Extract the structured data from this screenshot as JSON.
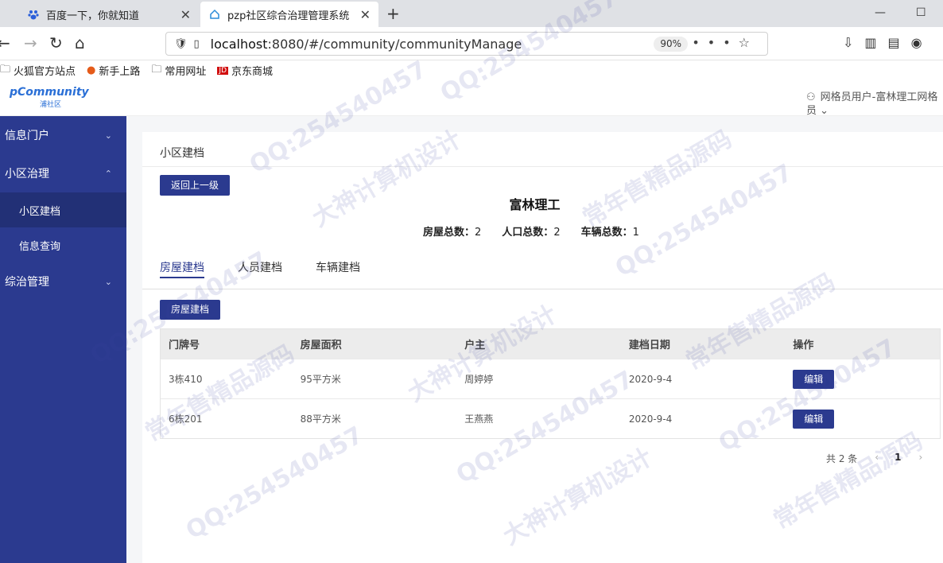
{
  "browser": {
    "tabs": [
      {
        "title": "百度一下，你就知道",
        "active": false
      },
      {
        "title": "pzp社区综合治理管理系统",
        "active": true
      }
    ],
    "url": {
      "host": "localhost",
      "rest": ":8080/#/community/communityManage"
    },
    "zoom": "90%",
    "bookmarks": [
      "火狐官方站点",
      "新手上路",
      "常用网址",
      "京东商城"
    ]
  },
  "app": {
    "logo": {
      "brand": "pCommunity",
      "sub": "浦社区"
    },
    "user": "网格员用户-富林理工网格员"
  },
  "sidebar": {
    "items": [
      {
        "label": "信息门户",
        "arrow": "⌄"
      },
      {
        "label": "小区治理",
        "arrow": "⌃",
        "children": [
          {
            "label": "小区建档",
            "active": true
          },
          {
            "label": "信息查询",
            "active": false
          }
        ]
      },
      {
        "label": "综治管理",
        "arrow": "⌄"
      }
    ]
  },
  "main": {
    "title": "小区建档",
    "back_label": "返回上一级",
    "community_name": "富林理工",
    "stats": [
      {
        "label": "房屋总数：",
        "value": "2"
      },
      {
        "label": "人口总数：",
        "value": "2"
      },
      {
        "label": "车辆总数：",
        "value": "1"
      }
    ],
    "subtabs": [
      "房屋建档",
      "人员建档",
      "车辆建档"
    ],
    "add_label": "房屋建档",
    "table": {
      "headers": [
        "门牌号",
        "房屋面积",
        "户主",
        "建档日期",
        "操作"
      ],
      "rows": [
        {
          "door": "3栋410",
          "area": "95平方米",
          "owner": "周婷婷",
          "date": "2020-9-4",
          "action": "编辑"
        },
        {
          "door": "6栋201",
          "area": "88平方米",
          "owner": "王燕燕",
          "date": "2020-9-4",
          "action": "编辑"
        }
      ]
    },
    "pager": {
      "total": "共 2 条",
      "page": "1"
    }
  },
  "watermarks": [
    "QQ:254540457",
    "常年售精品源码",
    "大神计算机设计"
  ]
}
